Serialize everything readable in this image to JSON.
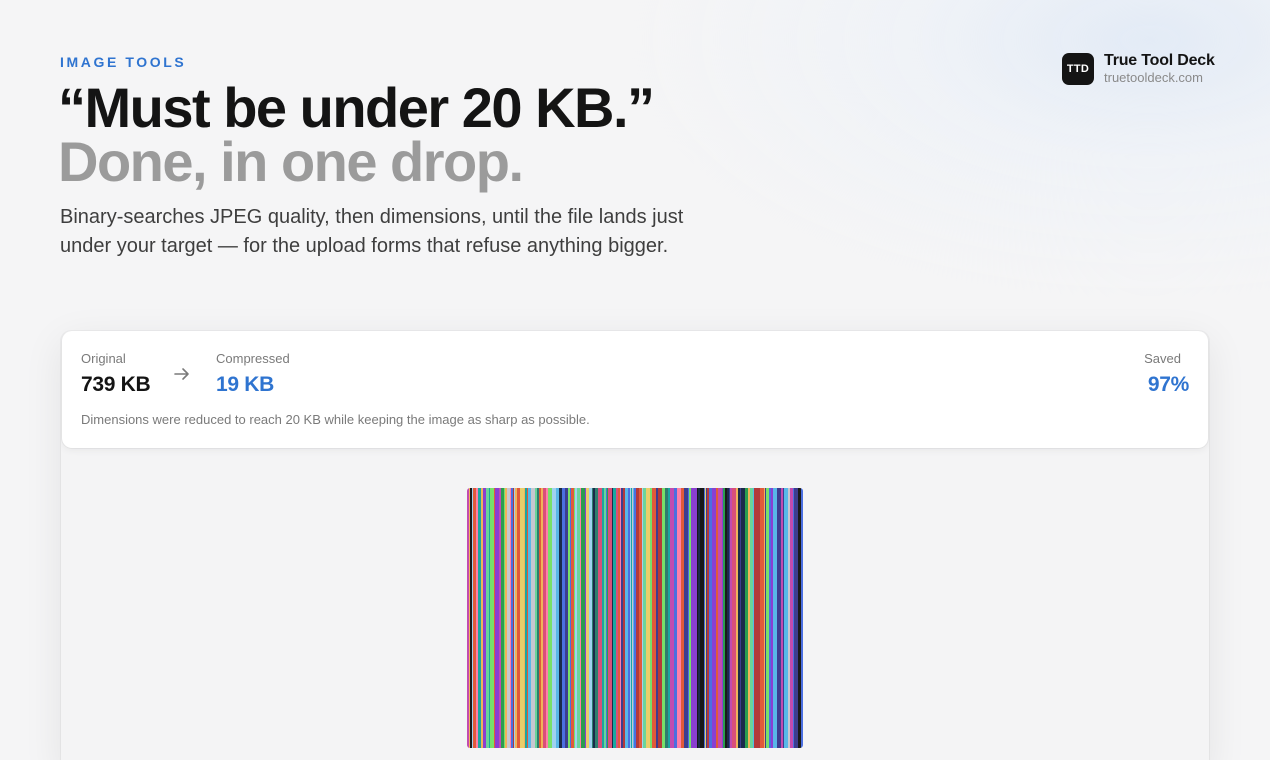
{
  "header": {
    "eyebrow": "IMAGE TOOLS",
    "headline_line1": "“Must be under 20 KB.”",
    "headline_line2": "Done, in one drop.",
    "subtitle": "Binary-searches JPEG quality, then dimensions, until the file lands just under your target — for the upload forms that refuse anything bigger."
  },
  "brand": {
    "logo_text": "TTD",
    "name": "True Tool Deck",
    "url": "truetooldeck.com"
  },
  "result": {
    "original_label": "Original",
    "original_value": "739 KB",
    "compressed_label": "Compressed",
    "compressed_value": "19 KB",
    "saved_label": "Saved",
    "saved_value": "97%",
    "note": "Dimensions were reduced to reach 20 KB while keeping the image as sharp as possible.",
    "arrow_icon": "arrow-right-icon"
  },
  "preview": {
    "icon": "compressed-image-preview",
    "stripe_colors": [
      "#1b2a4a",
      "#1aa7a0",
      "#d94f7a",
      "#8a3fd1",
      "#f0b35a",
      "#2b9d4f",
      "#c7c7d0",
      "#4b6fe0",
      "#e05a3a",
      "#6bd49a",
      "#1a1a1a",
      "#c24bb0",
      "#58b7e8",
      "#e8cf6a",
      "#3d3d8f",
      "#ff7fa8",
      "#2e7d6e",
      "#9fd1f0",
      "#b33a3a",
      "#77e06a"
    ],
    "accent": "#2f74d0",
    "text_color": "#141414"
  }
}
